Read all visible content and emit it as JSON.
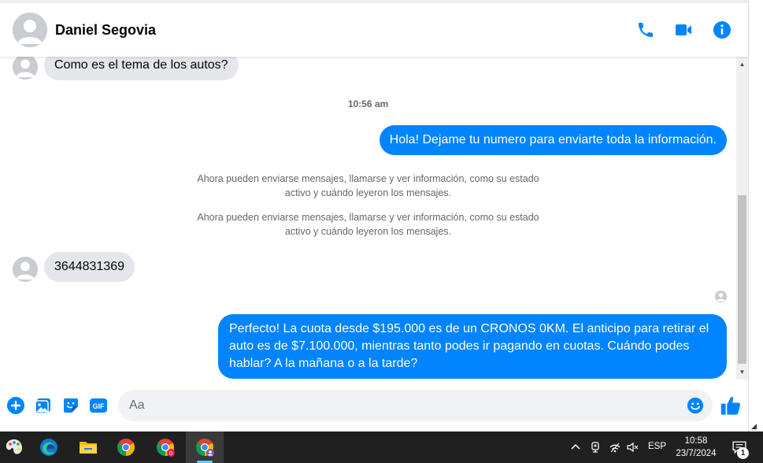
{
  "header": {
    "contact_name": "Daniel Segovia"
  },
  "conversation": {
    "messages": [
      {
        "direction": "incoming",
        "text": "Como es el tema de los autos?"
      },
      {
        "direction": "timestamp",
        "text": "10:56 am"
      },
      {
        "direction": "outgoing",
        "text": "Hola! Dejame tu numero  para enviarte toda la información."
      },
      {
        "direction": "system",
        "line1": "Ahora pueden enviarse mensajes, llamarse y ver información, como su estado",
        "line2": "activo y cuándo leyeron los mensajes."
      },
      {
        "direction": "system",
        "line1": "Ahora pueden enviarse mensajes, llamarse y ver información, como su estado",
        "line2": "activo y cuándo leyeron los mensajes."
      },
      {
        "direction": "incoming",
        "text": "3644831369"
      },
      {
        "direction": "outgoing",
        "line1": "Perfecto! La cuota desde $195.000 es de un CRONOS 0KM. El anticipo para retirar el",
        "line2": "auto es de $7.100.000, mientras tanto podes ir pagando en cuotas. Cuándo podes",
        "line3": "hablar? A la mañana o a la tarde?"
      }
    ]
  },
  "composer": {
    "placeholder": "Aa",
    "buttons": {
      "gif_label": "GIF"
    }
  },
  "taskbar": {
    "language": "ESP",
    "time": "10:58",
    "date": "23/7/2024",
    "notification_count": "1",
    "chrome_badge": "0"
  },
  "colors": {
    "messenger_blue": "#0084ff",
    "incoming_bubble": "#e4e6eb",
    "taskbar": "#202020"
  }
}
